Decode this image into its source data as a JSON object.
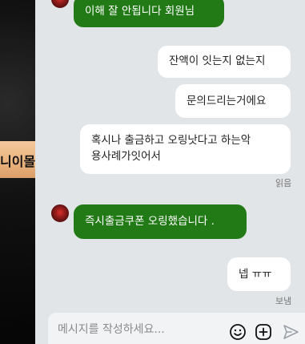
{
  "background": {
    "banner_text": "니이몰"
  },
  "messages": [
    {
      "side": "in",
      "text": "이해 잘 안됩니다 회원님"
    },
    {
      "side": "out",
      "text": "잔액이 잇는지 없는지"
    },
    {
      "side": "out",
      "text": "문의드리는거에요"
    },
    {
      "side": "out",
      "line1": "혹시나 출금하고 오링낫다고 하는악",
      "line2": "용사례가잇어서"
    },
    {
      "side": "in",
      "text": "즉시출금쿠폰 오링했습니다 ."
    },
    {
      "side": "out",
      "text": "넵 ㅠㅠ"
    }
  ],
  "status": {
    "read": "읽음",
    "sent": "보냄"
  },
  "composer": {
    "placeholder": "메시지를 작성하세요...",
    "icons": [
      "emoji-icon",
      "plus-icon",
      "send-icon"
    ]
  },
  "colors": {
    "incoming": "#227a16",
    "outgoing": "#ffffff",
    "chat_bg": "#e2e5e8"
  }
}
